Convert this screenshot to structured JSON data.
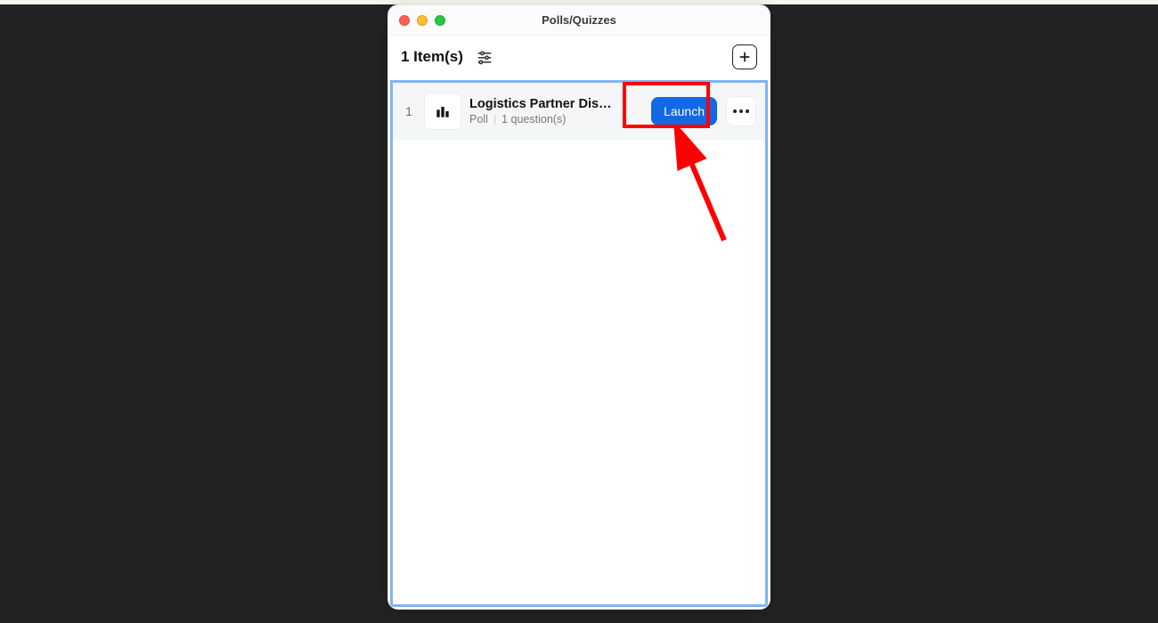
{
  "window": {
    "title": "Polls/Quizzes"
  },
  "toolbar": {
    "count_label": "1 Item(s)"
  },
  "items": [
    {
      "index": "1",
      "title": "Logistics Partner Dis…",
      "type_label": "Poll",
      "question_label": "1 question(s)",
      "launch_label": "Launch"
    }
  ],
  "annotation": {
    "purpose": "highlight-launch-button",
    "color": "#ff0000"
  }
}
